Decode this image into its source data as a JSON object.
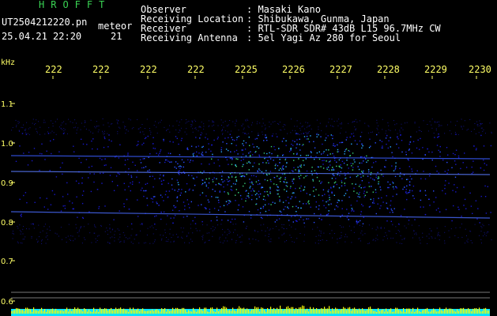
{
  "header": {
    "brand": "HROFFT",
    "file_name": "UT2504212220.pn",
    "kind": "meteor",
    "date_time": "25.04.21 22:20",
    "counter": "21",
    "info_rows": [
      {
        "label": "Observer",
        "value": "Masaki Kano"
      },
      {
        "label": "Receiving Location",
        "value": "Shibukawa, Gunma, Japan"
      },
      {
        "label": "Receiver",
        "value": "RTL-SDR SDR# 43dB L15 96.7MHz CW"
      },
      {
        "label": "Receiving Antenna",
        "value": "5el Yagi Az 280 for Seoul"
      }
    ]
  },
  "spectrogram": {
    "freq_unit": "kHz",
    "time_ticks": [
      "222",
      "222",
      "222",
      "222",
      "2225",
      "2226",
      "2227",
      "2228",
      "2229",
      "2230"
    ],
    "freq_ticks": [
      "1.1",
      "1.0",
      "0.9",
      "0.8",
      "0.7",
      "0.6"
    ],
    "colors": {
      "background": "#000000",
      "accent_text": "#ffff66",
      "brand": "#39d353",
      "noise_base": "#1818c8",
      "bottom_strip": "#00e5ff",
      "bottom_spikes": "#ffff00"
    }
  }
}
